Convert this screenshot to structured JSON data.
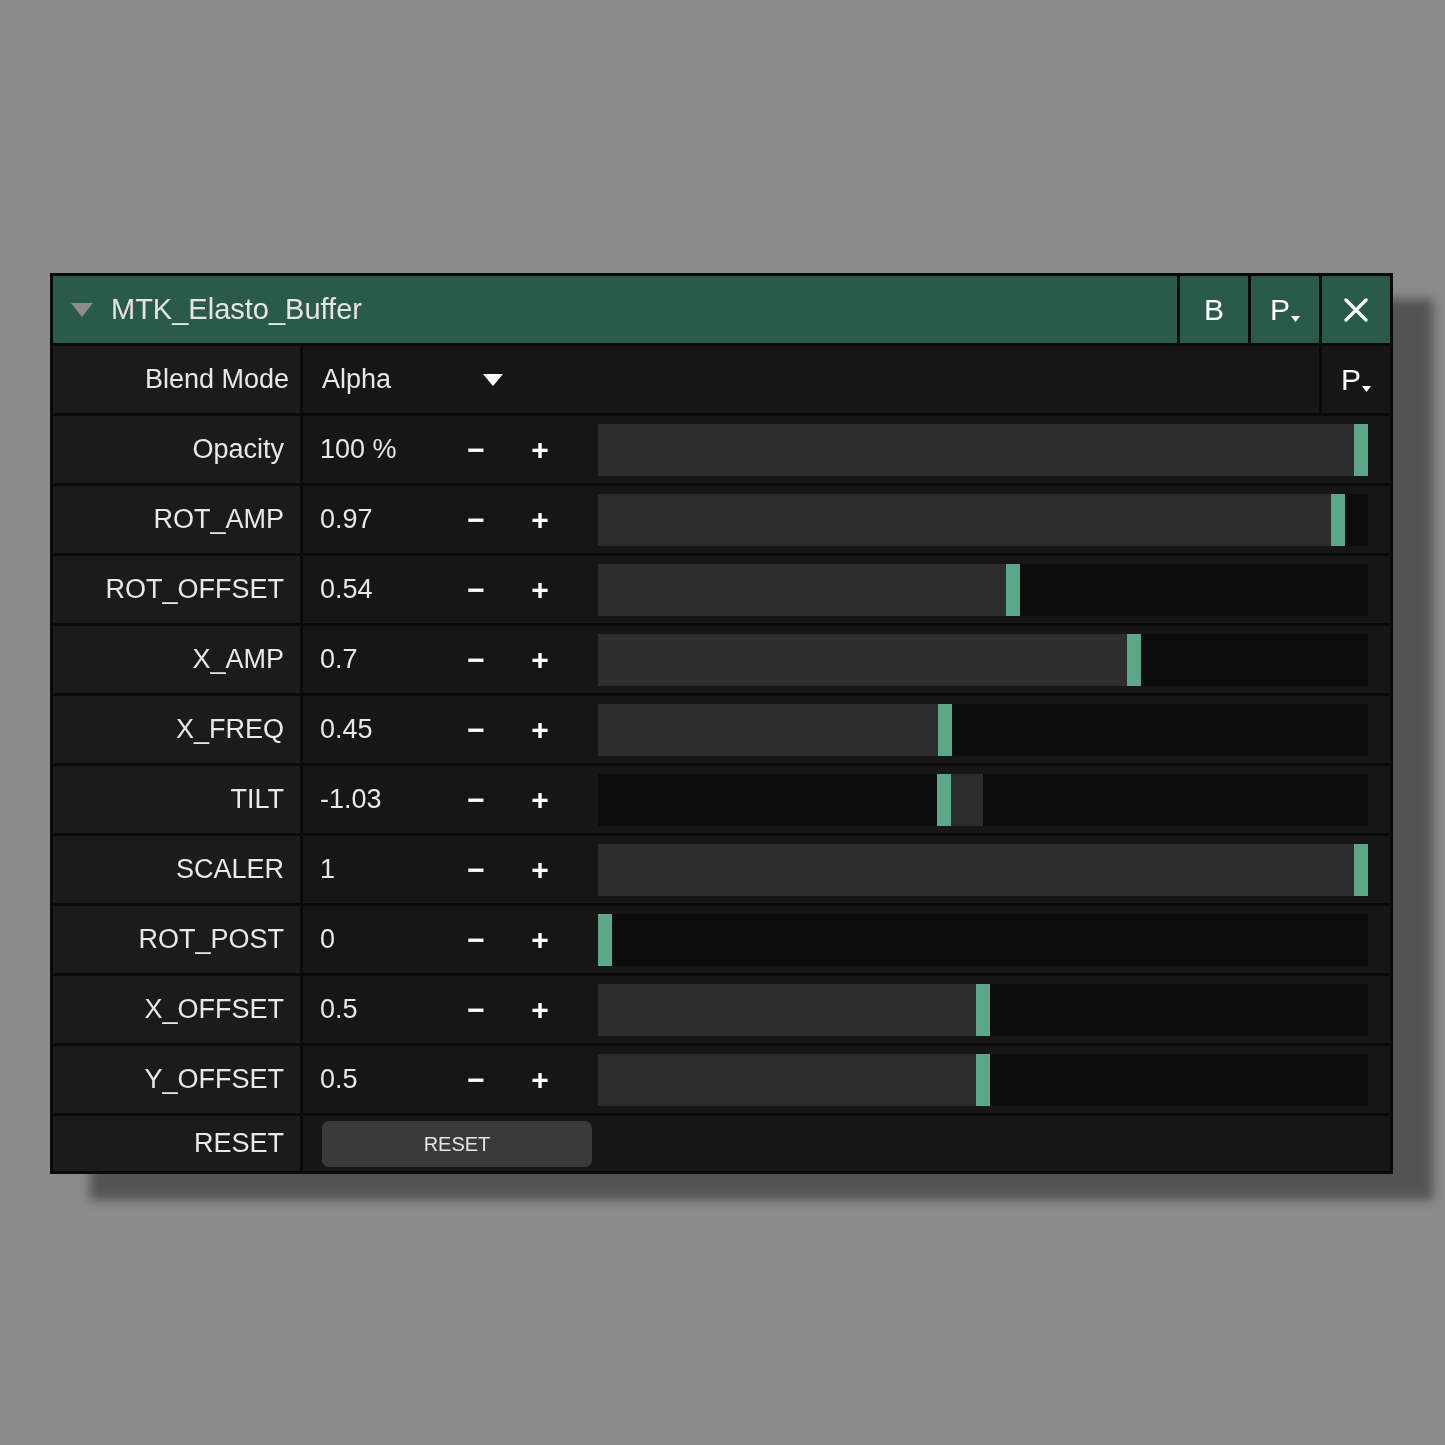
{
  "panel": {
    "title": "MTK_Elasto_Buffer",
    "expanded": true,
    "header_buttons": [
      {
        "kind": "text",
        "label": "B"
      },
      {
        "kind": "menu",
        "label": "P"
      },
      {
        "kind": "close"
      }
    ]
  },
  "rows": [
    {
      "kind": "dropdown",
      "label": "Blend Mode",
      "value": "Alpha",
      "menu_button": "P"
    },
    {
      "kind": "slider",
      "label": "Opacity",
      "value": "100 %",
      "decrement": "−",
      "increment": "+",
      "level": 1
    },
    {
      "kind": "slider",
      "label": "ROT_AMP",
      "value": "0.97",
      "decrement": "−",
      "increment": "+",
      "level": 0.97
    },
    {
      "kind": "slider",
      "label": "ROT_OFFSET",
      "value": "0.54",
      "decrement": "−",
      "increment": "+",
      "level": 0.54
    },
    {
      "kind": "slider",
      "label": "X_AMP",
      "value": "0.7",
      "decrement": "−",
      "increment": "+",
      "level": 0.7
    },
    {
      "kind": "slider",
      "label": "X_FREQ",
      "value": "0.45",
      "decrement": "−",
      "increment": "+",
      "level": 0.45
    },
    {
      "kind": "bipolar",
      "label": "TILT",
      "value": "-1.03",
      "decrement": "−",
      "increment": "+",
      "level": 0.448
    },
    {
      "kind": "slider",
      "label": "SCALER",
      "value": "1",
      "decrement": "−",
      "increment": "+",
      "level": 1
    },
    {
      "kind": "slider",
      "label": "ROT_POST",
      "value": "0",
      "decrement": "−",
      "increment": "+",
      "level": 0
    },
    {
      "kind": "slider",
      "label": "X_OFFSET",
      "value": "0.5",
      "decrement": "−",
      "increment": "+",
      "level": 0.5
    },
    {
      "kind": "slider",
      "label": "Y_OFFSET",
      "value": "0.5",
      "decrement": "−",
      "increment": "+",
      "level": 0.5
    },
    {
      "kind": "button",
      "label": "RESET",
      "button": "RESET"
    }
  ]
}
